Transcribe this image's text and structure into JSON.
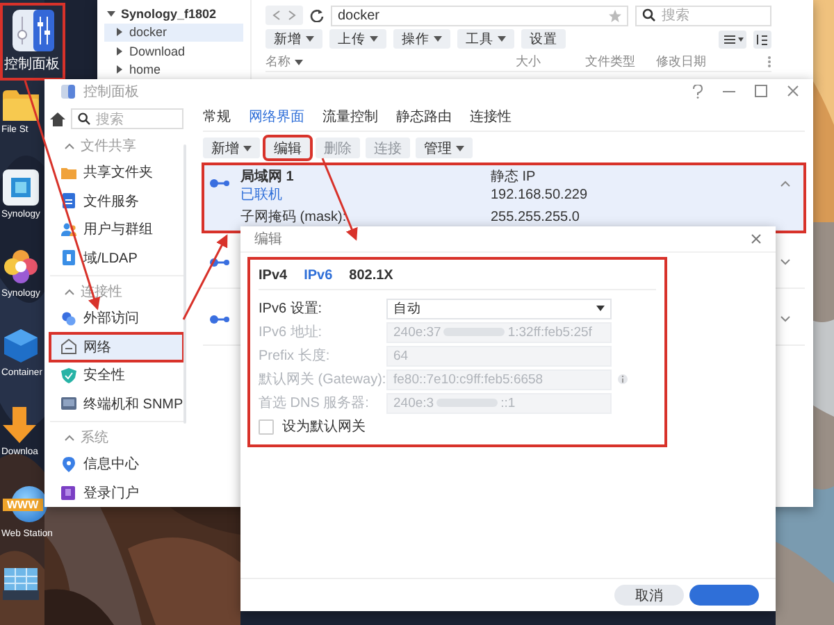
{
  "desktop": {
    "icons": [
      {
        "kind": "control-panel",
        "label": "控制面板",
        "annotated": true
      },
      {
        "kind": "folder",
        "label": "File St",
        "annotated": false
      },
      {
        "kind": "photos",
        "label": "Synology",
        "annotated": false
      },
      {
        "kind": "flower",
        "label": "Synology",
        "annotated": false
      },
      {
        "kind": "container",
        "label": "Container",
        "annotated": false
      },
      {
        "kind": "download",
        "label": "Downloa",
        "annotated": false
      },
      {
        "kind": "www",
        "label": "Web Station",
        "badge": "WWW",
        "annotated": false
      },
      {
        "kind": "storage",
        "annotated": false
      }
    ]
  },
  "file_station": {
    "tree": [
      {
        "label": "Synology_f1802",
        "expanded": true,
        "selected": false,
        "children": [
          {
            "label": "docker",
            "expanded": false,
            "selected": true
          },
          {
            "label": "Download",
            "expanded": false,
            "selected": false
          },
          {
            "label": "home",
            "expanded": false,
            "selected": false
          }
        ]
      }
    ],
    "path": "docker",
    "search_placeholder": "搜索",
    "buttons": [
      {
        "label": "新增",
        "dropdown": true
      },
      {
        "label": "上传",
        "dropdown": true
      },
      {
        "label": "操作",
        "dropdown": true
      },
      {
        "label": "工具",
        "dropdown": true
      },
      {
        "label": "设置",
        "dropdown": false
      }
    ],
    "columns": [
      {
        "label": "名称",
        "sorted": true
      },
      {
        "label": "大小",
        "sorted": false
      },
      {
        "label": "文件类型",
        "sorted": false
      },
      {
        "label": "修改日期",
        "sorted": false
      }
    ]
  },
  "control_panel": {
    "title": "控制面板",
    "search_placeholder": "搜索",
    "sidebar": [
      {
        "group": "文件共享",
        "expanded": true,
        "items": [
          {
            "label": "共享文件夹",
            "kind": "folder",
            "selected": false,
            "annotated": false
          },
          {
            "label": "文件服务",
            "kind": "file-service",
            "selected": false,
            "annotated": false
          },
          {
            "label": "用户与群组",
            "kind": "users",
            "selected": false,
            "annotated": false
          },
          {
            "label": "域/LDAP",
            "kind": "directory",
            "selected": false,
            "annotated": false
          }
        ]
      },
      {
        "group": "连接性",
        "expanded": true,
        "items": [
          {
            "label": "外部访问",
            "kind": "external",
            "selected": false,
            "annotated": false
          },
          {
            "label": "网络",
            "kind": "network",
            "selected": true,
            "annotated": true
          },
          {
            "label": "安全性",
            "kind": "security",
            "selected": false,
            "annotated": false
          },
          {
            "label": "终端机和 SNMP",
            "kind": "terminal",
            "selected": false,
            "annotated": false
          }
        ]
      },
      {
        "group": "系统",
        "expanded": true,
        "items": [
          {
            "label": "信息中心",
            "kind": "info",
            "selected": false,
            "annotated": false
          },
          {
            "label": "登录门户",
            "kind": "portal",
            "selected": false,
            "annotated": false
          }
        ]
      }
    ],
    "tabs": [
      {
        "label": "常规",
        "selected": false
      },
      {
        "label": "网络界面",
        "selected": true
      },
      {
        "label": "流量控制",
        "selected": false
      },
      {
        "label": "静态路由",
        "selected": false
      },
      {
        "label": "连接性",
        "selected": false
      }
    ],
    "toolbar": [
      {
        "label": "新增",
        "dropdown": true,
        "disabled": false,
        "annotated": false
      },
      {
        "label": "编辑",
        "dropdown": false,
        "disabled": false,
        "annotated": true
      },
      {
        "label": "删除",
        "dropdown": false,
        "disabled": true,
        "annotated": false
      },
      {
        "label": "连接",
        "dropdown": false,
        "disabled": true,
        "annotated": false
      },
      {
        "label": "管理",
        "dropdown": true,
        "disabled": false,
        "annotated": false
      }
    ],
    "interfaces": [
      {
        "name": "局域网 1",
        "status": "已联机",
        "mask_label": "子网掩码 (mask):",
        "type": "静态 IP",
        "ip": "192.168.50.229",
        "mask": "255.255.255.0",
        "expanded": true,
        "selected": true,
        "annotated": true
      },
      {
        "expanded": false,
        "selected": false,
        "annotated": false
      },
      {
        "expanded": false,
        "selected": false,
        "annotated": false
      }
    ]
  },
  "dialog": {
    "title": "编辑",
    "annotated": true,
    "tabs": [
      {
        "label": "IPv4",
        "selected": false
      },
      {
        "label": "IPv6",
        "selected": true
      },
      {
        "label": "802.1X",
        "selected": false
      }
    ],
    "fields": [
      {
        "label": "IPv6 设置:",
        "kind": "select",
        "value": "自动",
        "disabled": false
      },
      {
        "label": "IPv6 地址:",
        "kind": "text",
        "value": "240e:37",
        "value_end": "1:32ff:feb5:25f",
        "redacted": true,
        "disabled": true
      },
      {
        "label": "Prefix 长度:",
        "kind": "text",
        "value": "64",
        "disabled": true
      },
      {
        "label": "默认网关 (Gateway):",
        "kind": "text",
        "value": "fe80::7e10:c9ff:feb5:6658",
        "disabled": true,
        "info": true
      },
      {
        "label": "首选 DNS 服务器:",
        "kind": "text",
        "value": "240e:3",
        "value_end": "::1",
        "redacted": true,
        "disabled": true
      }
    ],
    "checkbox": {
      "label": "设为默认网关",
      "checked": false
    },
    "buttons": [
      {
        "kind": "secondary",
        "label": "取消"
      },
      {
        "kind": "primary"
      }
    ]
  }
}
